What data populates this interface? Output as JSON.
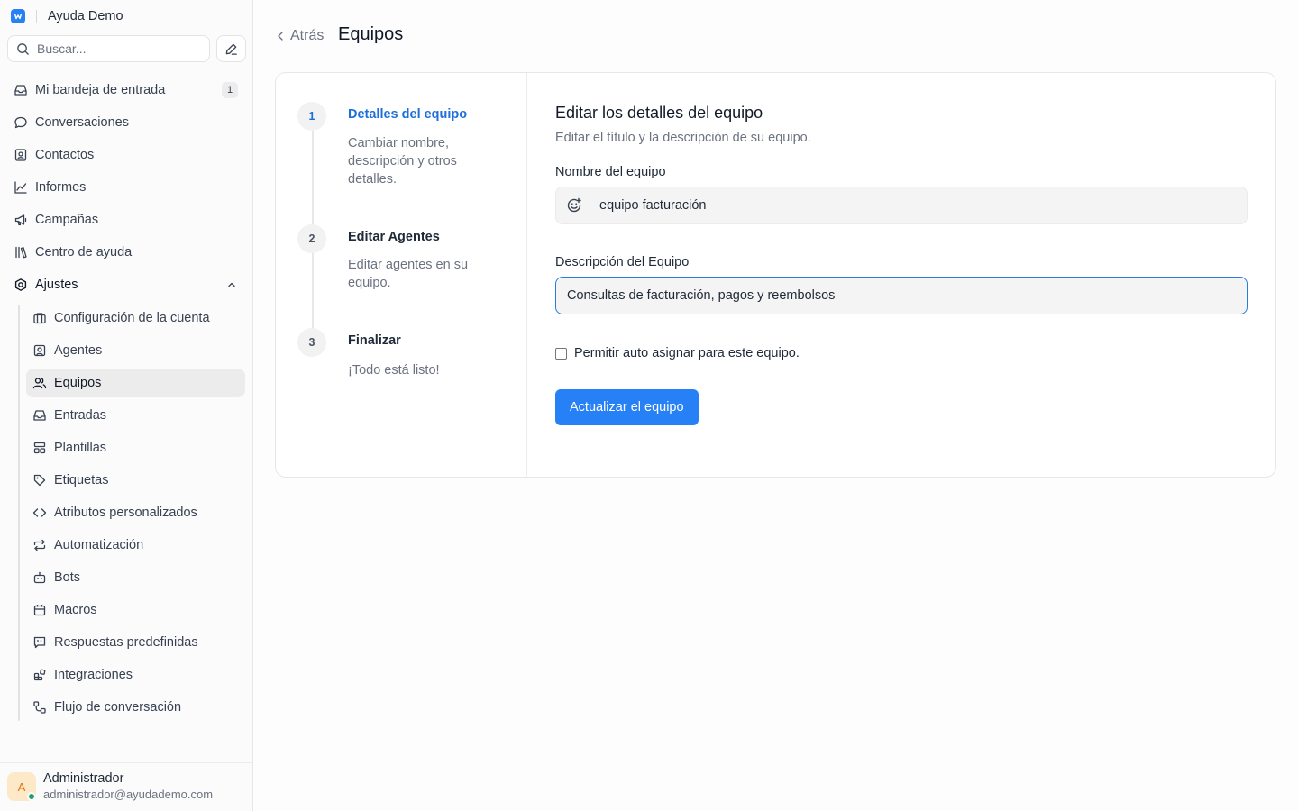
{
  "brand": {
    "name": "Ayuda Demo"
  },
  "search": {
    "placeholder": "Buscar..."
  },
  "nav": {
    "items": [
      {
        "label": "Mi bandeja de entrada",
        "badge": "1"
      },
      {
        "label": "Conversaciones"
      },
      {
        "label": "Contactos"
      },
      {
        "label": "Informes"
      },
      {
        "label": "Campañas"
      },
      {
        "label": "Centro de ayuda"
      },
      {
        "label": "Ajustes"
      }
    ],
    "settings_items": [
      {
        "label": "Configuración de la cuenta"
      },
      {
        "label": "Agentes"
      },
      {
        "label": "Equipos",
        "active": true
      },
      {
        "label": "Entradas"
      },
      {
        "label": "Plantillas"
      },
      {
        "label": "Etiquetas"
      },
      {
        "label": "Atributos personalizados"
      },
      {
        "label": "Automatización"
      },
      {
        "label": "Bots"
      },
      {
        "label": "Macros"
      },
      {
        "label": "Respuestas predefinidas"
      },
      {
        "label": "Integraciones"
      },
      {
        "label": "Flujo de conversación"
      }
    ]
  },
  "user": {
    "initial": "A",
    "name": "Administrador",
    "email": "administrador@ayudademo.com",
    "status": "online"
  },
  "header": {
    "back_label": "Atrás",
    "title": "Equipos"
  },
  "steps": [
    {
      "number": "1",
      "title": "Detalles del equipo",
      "description": "Cambiar nombre, descripción y otros detalles.",
      "active": true
    },
    {
      "number": "2",
      "title": "Editar Agentes",
      "description": "Editar agentes en su equipo."
    },
    {
      "number": "3",
      "title": "Finalizar",
      "description": "¡Todo está listo!"
    }
  ],
  "form": {
    "title": "Editar los detalles del equipo",
    "subtitle": "Editar el título y la descripción de su equipo.",
    "name_label": "Nombre del equipo",
    "name_value": "equipo facturación",
    "description_label": "Descripción del Equipo",
    "description_value": "Consultas de facturación, pagos y reembolsos",
    "auto_assign_label": "Permitir auto asignar para este equipo.",
    "auto_assign_checked": false,
    "submit_label": "Actualizar el equipo"
  },
  "colors": {
    "accent": "#2781f6",
    "active_step": "#1e6fd9",
    "online": "#22a06b"
  }
}
